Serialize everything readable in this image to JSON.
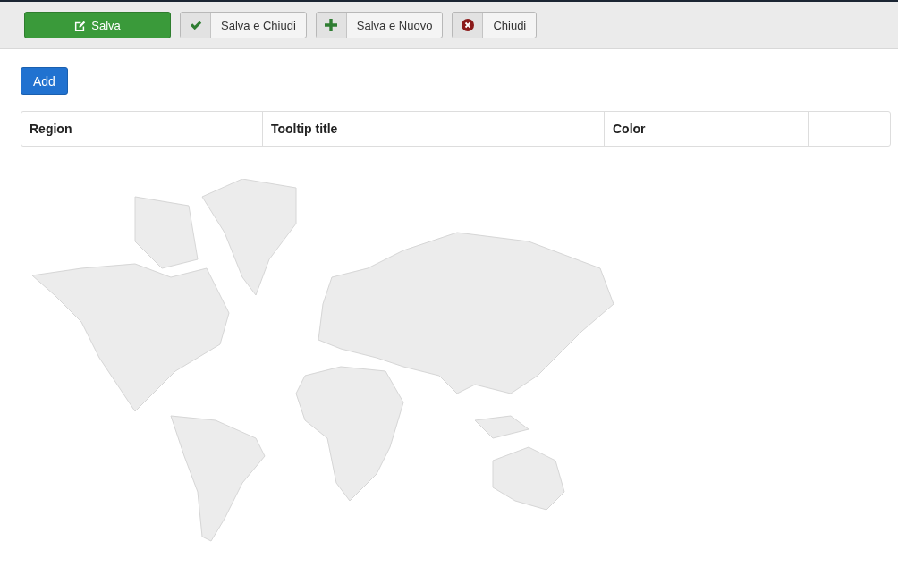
{
  "toolbar": {
    "buttons": [
      {
        "label": "Salva",
        "kind": "edit"
      },
      {
        "label": "Salva e Chiudi",
        "kind": "check"
      },
      {
        "label": "Salva e Nuovo",
        "kind": "plus"
      },
      {
        "label": "Chiudi",
        "kind": "cancel"
      }
    ]
  },
  "add_button": "Add",
  "table": {
    "columns": [
      "Region",
      "Tooltip title",
      "Color"
    ]
  }
}
